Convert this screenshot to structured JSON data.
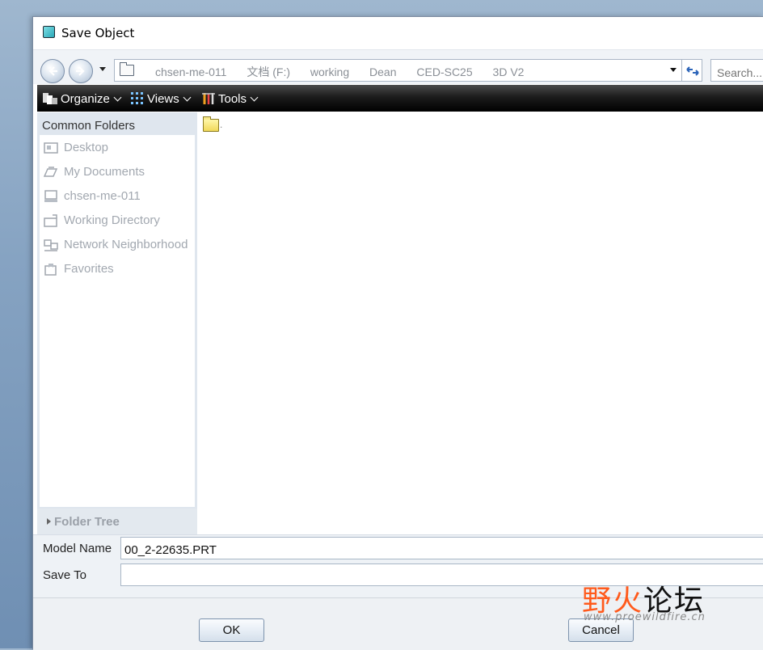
{
  "window": {
    "title": "Save Object"
  },
  "address_bar": {
    "crumbs": [
      "chsen-me-011",
      "文档 (F:)",
      "working",
      "Dean",
      "CED-SC25",
      "3D V2"
    ],
    "search_placeholder": "Search..."
  },
  "toolbar": {
    "organize_label": "Organize",
    "views_label": "Views",
    "tools_label": "Tools"
  },
  "sidebar": {
    "heading": "Common Folders",
    "items": [
      {
        "label": "Desktop",
        "icon": "desktop-icon"
      },
      {
        "label": "My Documents",
        "icon": "documents-icon"
      },
      {
        "label": "chsen-me-011",
        "icon": "computer-icon"
      },
      {
        "label": "Working Directory",
        "icon": "working-directory-icon"
      },
      {
        "label": "Network Neighborhood",
        "icon": "network-icon"
      },
      {
        "label": "Favorites",
        "icon": "favorites-icon"
      }
    ],
    "folder_tree_label": "Folder Tree"
  },
  "files": [
    {
      "name": ".",
      "icon": "folder-icon"
    }
  ],
  "form": {
    "model_name_label": "Model Name",
    "model_name_value": "00_2-22635.PRT",
    "save_to_label": "Save To",
    "save_to_value": ""
  },
  "buttons": {
    "ok_label": "OK",
    "cancel_label": "Cancel"
  },
  "watermark": {
    "cn_text_part1": "野火",
    "cn_text_part2": "论坛",
    "url": "www.proewildfire.cn"
  },
  "colors": {
    "toolbar_bg": "#000000",
    "accent_orange": "#ff5a1c",
    "sidebar_bg": "#dfe6ee"
  }
}
